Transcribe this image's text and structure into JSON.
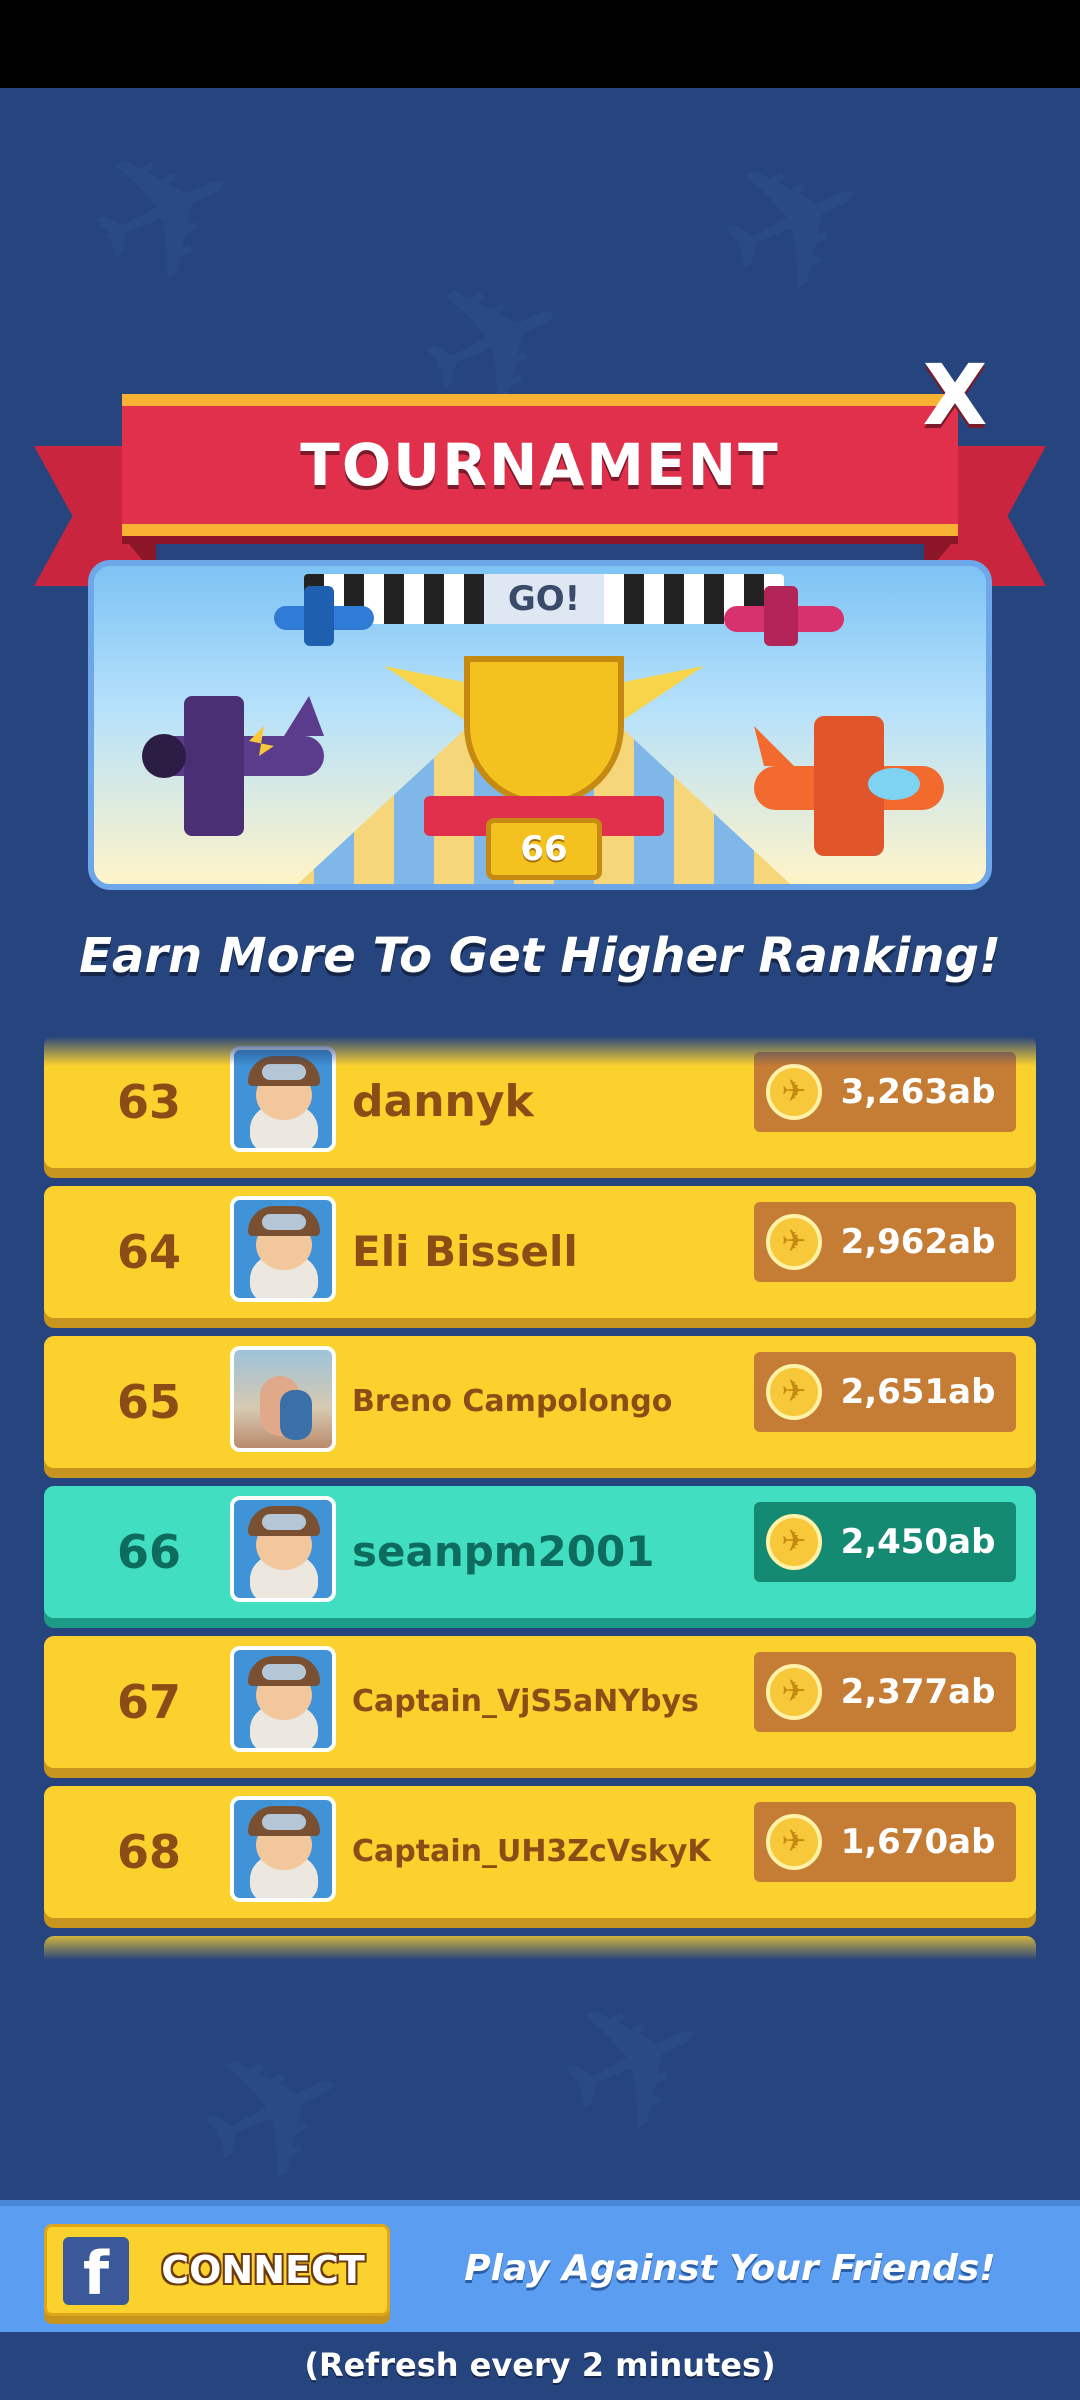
{
  "header": {
    "title": "TOURNAMENT",
    "close_label": "X"
  },
  "banner": {
    "flag_text": "GO!",
    "trophy_rank": "66"
  },
  "subtitle": "Earn More To Get Higher Ranking!",
  "leaderboard": {
    "rows": [
      {
        "rank": "63",
        "name": "dannyk",
        "score": "3,263ab",
        "avatar": "pilot-avatar"
      },
      {
        "rank": "64",
        "name": "Eli Bissell",
        "score": "2,962ab",
        "avatar": "pilot-avatar"
      },
      {
        "rank": "65",
        "name": "Breno Campolongo",
        "score": "2,651ab",
        "avatar": "photo-avatar"
      },
      {
        "rank": "66",
        "name": "seanpm2001",
        "score": "2,450ab",
        "avatar": "pilot-avatar",
        "current": true
      },
      {
        "rank": "67",
        "name": "Captain_VjS5aNYbys",
        "score": "2,377ab",
        "avatar": "pilot-avatar"
      },
      {
        "rank": "68",
        "name": "Captain_UH3ZcVskyK",
        "score": "1,670ab",
        "avatar": "pilot-avatar"
      }
    ]
  },
  "facebook": {
    "connect_label": "CONNECT",
    "promo_text": "Play Against Your Friends!"
  },
  "footer": {
    "refresh_text": "(Refresh every 2 minutes)"
  },
  "colors": {
    "background": "#26447d",
    "row_yellow": "#fbd12d",
    "row_current": "#41dec2",
    "ribbon_red": "#e0304b"
  }
}
